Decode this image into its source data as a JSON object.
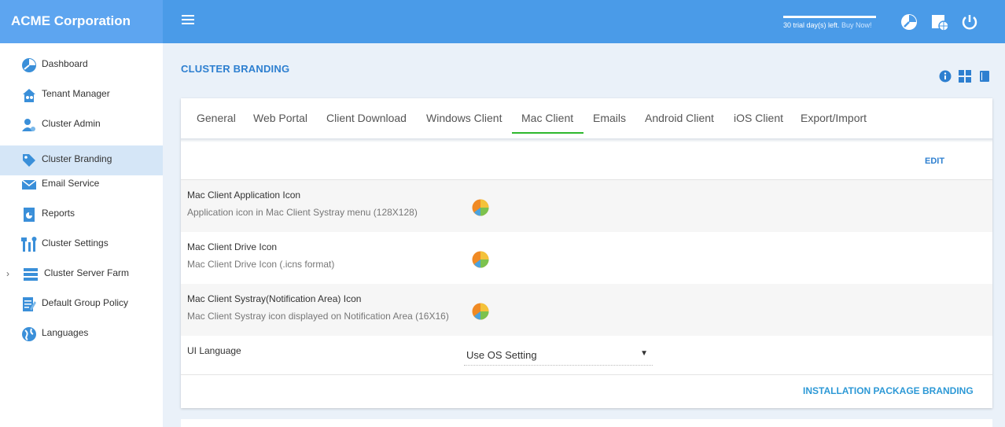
{
  "app": {
    "brand": "ACME Corporation"
  },
  "sidebar": {
    "items": [
      {
        "label": "Dashboard",
        "icon": "dashboard-icon"
      },
      {
        "label": "Tenant Manager",
        "icon": "tenant-icon"
      },
      {
        "label": "Cluster Admin",
        "icon": "admin-icon"
      },
      {
        "label": "Cluster Branding",
        "icon": "branding-tag-icon",
        "active": true
      },
      {
        "label": "Email Service",
        "icon": "email-icon"
      },
      {
        "label": "Reports",
        "icon": "reports-icon"
      },
      {
        "label": "Cluster Settings",
        "icon": "tools-icon"
      },
      {
        "label": "Cluster Server Farm",
        "icon": "server-icon",
        "expandable": true
      },
      {
        "label": "Default Group Policy",
        "icon": "policy-icon"
      },
      {
        "label": "Languages",
        "icon": "globe-icon"
      }
    ]
  },
  "topbar": {
    "trial_text": "30 trial day(s) left.",
    "buy_link": "Buy Now!",
    "icons": [
      "dashboard-icon",
      "web-portal-icon",
      "power-icon"
    ]
  },
  "page": {
    "title": "CLUSTER BRANDING",
    "view_icons": [
      "info-icon",
      "grid-view-icon",
      "book-icon"
    ]
  },
  "tabs": [
    {
      "label": "General"
    },
    {
      "label": "Web Portal"
    },
    {
      "label": "Client Download"
    },
    {
      "label": "Windows Client"
    },
    {
      "label": "Mac Client",
      "active": true
    },
    {
      "label": "Emails"
    },
    {
      "label": "Android Client"
    },
    {
      "label": "iOS Client"
    },
    {
      "label": "Export/Import"
    }
  ],
  "edit_label": "EDIT",
  "rows": [
    {
      "title": "Mac Client Application Icon",
      "desc": "Application icon in Mac Client Systray menu (128X128)"
    },
    {
      "title": "Mac Client Drive Icon",
      "desc": "Mac Client Drive Icon (.icns format)"
    },
    {
      "title": "Mac Client Systray(Notification Area) Icon",
      "desc": "Mac Client Systray icon displayed on Notification Area (16X16)"
    }
  ],
  "ui_language": {
    "label": "UI Language",
    "value": "Use OS Setting"
  },
  "package_branding_link": "INSTALLATION PACKAGE BRANDING",
  "colors": {
    "topbar": "#4a9be8",
    "brand_bg": "#5da5f0",
    "accent": "#2d7fd0",
    "active_tab_underline": "#2eb82e"
  }
}
